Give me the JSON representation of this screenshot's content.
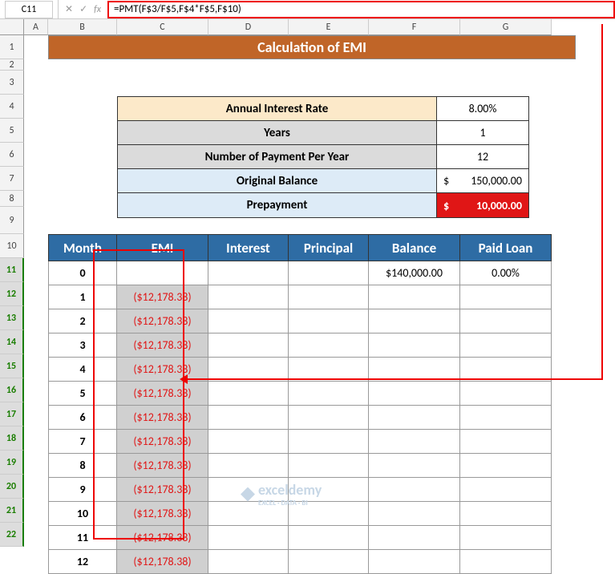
{
  "namebox": "C11",
  "formula": "=PMT(F$3/F$5,F$4*F$5,F$10)",
  "columns": [
    "A",
    "B",
    "C",
    "D",
    "E",
    "F",
    "G"
  ],
  "row_nums": [
    1,
    2,
    3,
    4,
    5,
    6,
    7,
    8,
    9,
    10,
    11,
    12,
    13,
    14,
    15,
    16,
    17,
    18,
    19,
    20,
    21,
    22
  ],
  "title": "Calculation of EMI",
  "params": {
    "rate_label": "Annual Interest Rate",
    "rate_val": "8.00%",
    "years_label": "Years",
    "years_val": "1",
    "npay_label": "Number of Payment Per Year",
    "npay_val": "12",
    "orig_label": "Original Balance",
    "orig_cur": "$",
    "orig_val": "150,000.00",
    "prepay_label": "Prepayment",
    "prepay_cur": "$",
    "prepay_val": "10,000.00"
  },
  "headers": {
    "month": "Month",
    "emi": "EMI",
    "interest": "Interest",
    "principal": "Principal",
    "balance": "Balance",
    "paid": "Paid Loan"
  },
  "rows": [
    {
      "month": "0",
      "emi": "",
      "bal_cur": "$",
      "bal": "140,000.00",
      "paid": "0.00%"
    },
    {
      "month": "1",
      "emi": "($12,178.38)"
    },
    {
      "month": "2",
      "emi": "($12,178.38)"
    },
    {
      "month": "3",
      "emi": "($12,178.38)"
    },
    {
      "month": "4",
      "emi": "($12,178.38)"
    },
    {
      "month": "5",
      "emi": "($12,178.38)"
    },
    {
      "month": "6",
      "emi": "($12,178.38)"
    },
    {
      "month": "7",
      "emi": "($12,178.38)"
    },
    {
      "month": "8",
      "emi": "($12,178.38)"
    },
    {
      "month": "9",
      "emi": "($12,178.38)"
    },
    {
      "month": "10",
      "emi": "($12,178.38)"
    },
    {
      "month": "11",
      "emi": "($12,178.38)"
    },
    {
      "month": "12",
      "emi": "($12,178.38)"
    }
  ],
  "fx_x": "✕",
  "fx_check": "✓",
  "fx_label": "fx",
  "watermark": "exceldemy",
  "watermark_sub": "EXCEL · DATA · BI",
  "chart_data": {
    "type": "table",
    "title": "Calculation of EMI",
    "parameters": {
      "annual_interest_rate": 0.08,
      "years": 1,
      "payments_per_year": 12,
      "original_balance": 150000.0,
      "prepayment": 10000.0,
      "starting_balance": 140000.0
    },
    "schedule": [
      {
        "month": 0,
        "emi": null,
        "interest": null,
        "principal": null,
        "balance": 140000.0,
        "paid_loan_pct": 0.0
      },
      {
        "month": 1,
        "emi": -12178.38
      },
      {
        "month": 2,
        "emi": -12178.38
      },
      {
        "month": 3,
        "emi": -12178.38
      },
      {
        "month": 4,
        "emi": -12178.38
      },
      {
        "month": 5,
        "emi": -12178.38
      },
      {
        "month": 6,
        "emi": -12178.38
      },
      {
        "month": 7,
        "emi": -12178.38
      },
      {
        "month": 8,
        "emi": -12178.38
      },
      {
        "month": 9,
        "emi": -12178.38
      },
      {
        "month": 10,
        "emi": -12178.38
      },
      {
        "month": 11,
        "emi": -12178.38
      },
      {
        "month": 12,
        "emi": -12178.38
      }
    ]
  }
}
